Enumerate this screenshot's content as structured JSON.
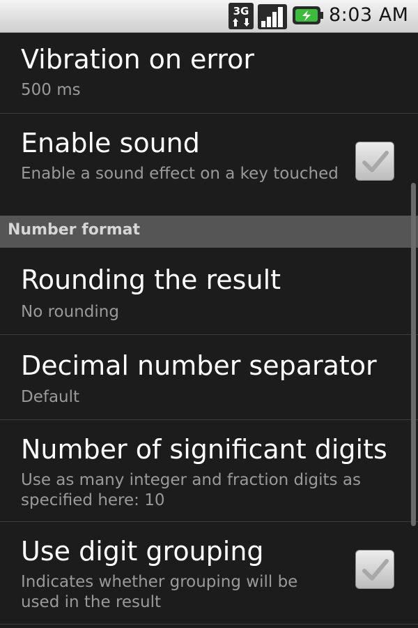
{
  "status_bar": {
    "network_label": "3G",
    "time": "8:03 AM",
    "icons": [
      "3g-data-icon",
      "signal-strength-icon",
      "battery-charging-icon"
    ]
  },
  "preferences": {
    "vibration": {
      "title": "Vibration on error",
      "summary": "500 ms"
    },
    "sound": {
      "title": "Enable sound",
      "summary": "Enable a sound effect on a key touched",
      "checked": true
    },
    "category_number_format": "Number format",
    "rounding": {
      "title": "Rounding the result",
      "summary": "No rounding"
    },
    "decimal_separator": {
      "title": "Decimal number separator",
      "summary": "Default"
    },
    "significant_digits": {
      "title": "Number of significant digits",
      "summary": "Use as many integer and fraction digits as specified here: 10"
    },
    "digit_grouping": {
      "title": "Use digit grouping",
      "summary": "Indicates whether grouping will be used in the result",
      "checked": true
    }
  },
  "colors": {
    "background": "#1c1c1c",
    "title_text": "#ffffff",
    "summary_text": "#9a9a9a",
    "category_bg": "#555555",
    "status_bar_bg": "#e6e6e6"
  }
}
